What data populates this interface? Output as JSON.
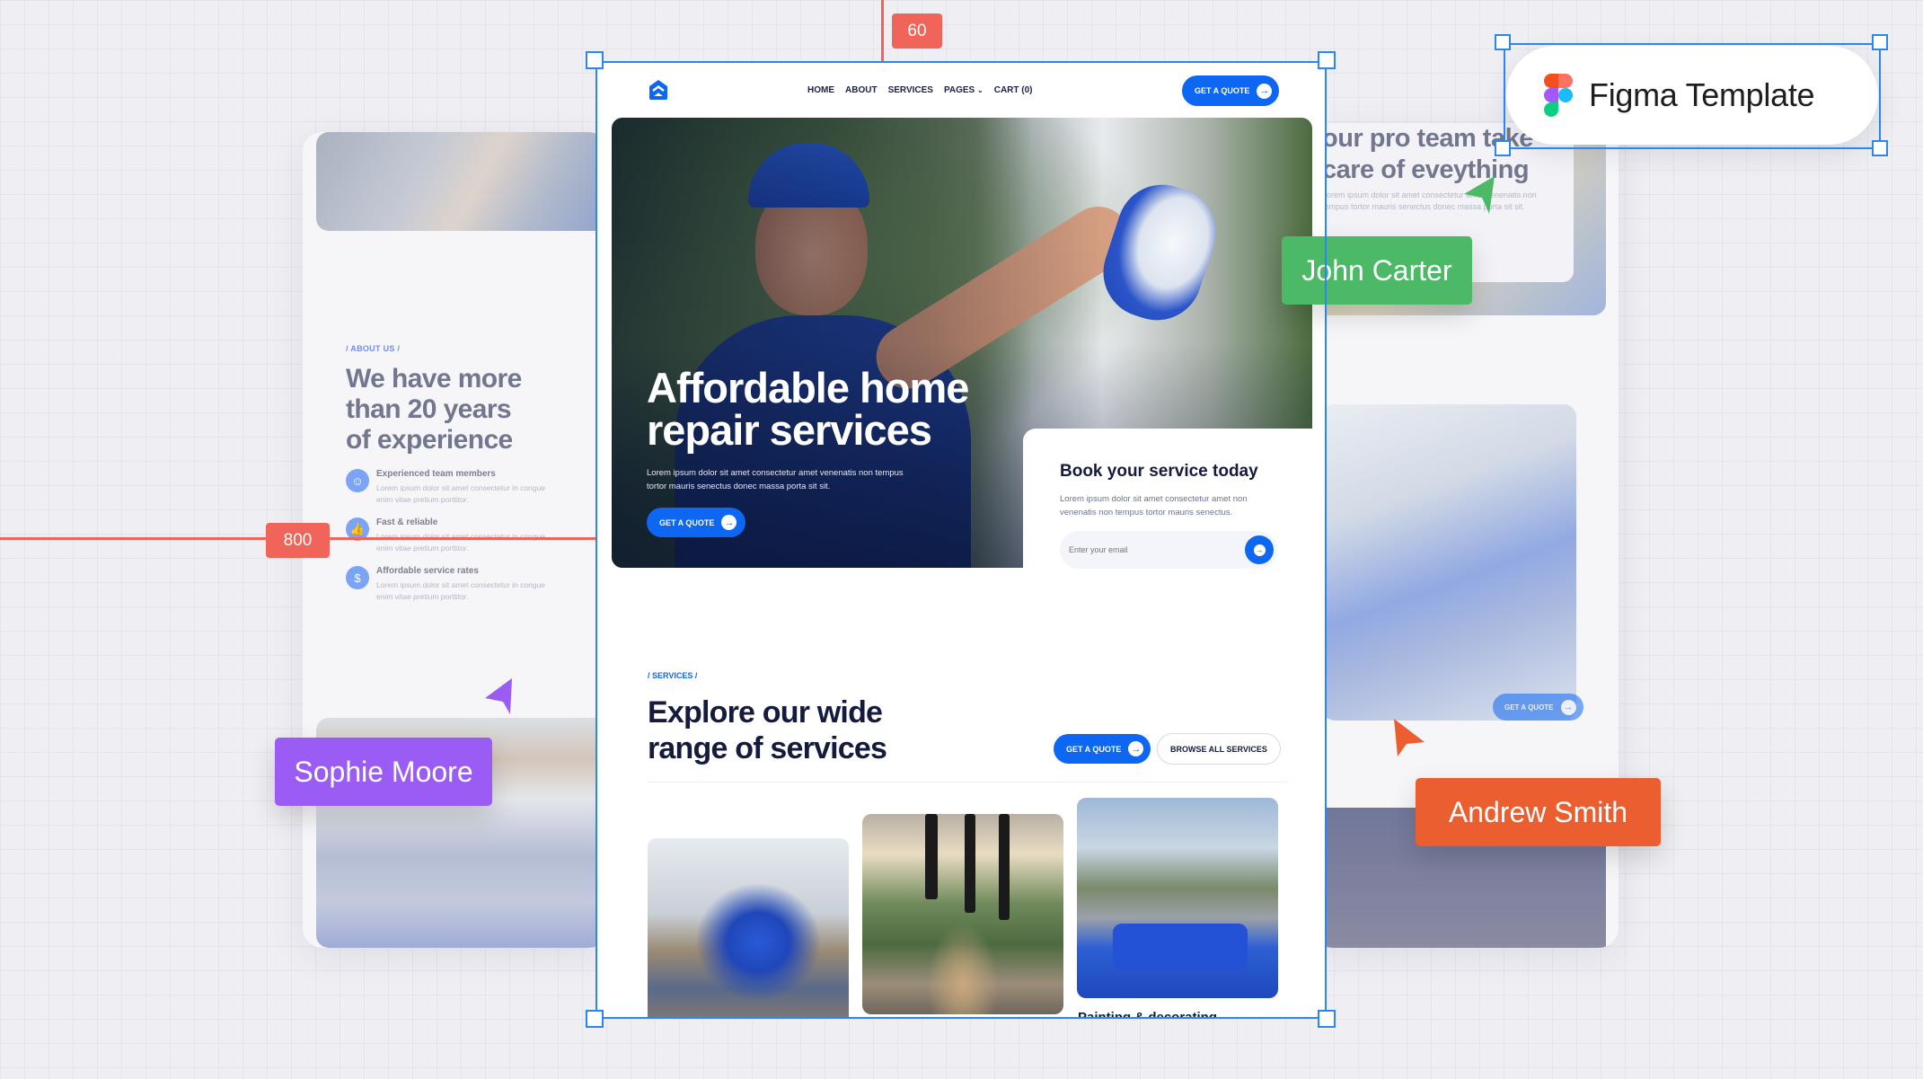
{
  "overlay": {
    "figma_label": "Figma Template",
    "measure_top": "60",
    "measure_left": "800",
    "cursors": [
      {
        "name": "John Carter",
        "color": "#4cb966"
      },
      {
        "name": "Sophie Moore",
        "color": "#9b5cf6"
      },
      {
        "name": "Andrew Smith",
        "color": "#eb5e30"
      }
    ]
  },
  "nav": {
    "logo_icon": "home-chevrons-icon",
    "links": [
      "HOME",
      "ABOUT",
      "SERVICES",
      "PAGES",
      "CART (0)"
    ],
    "cta": "GET A QUOTE"
  },
  "hero": {
    "title_line1": "Affordable home",
    "title_line2": "repair services",
    "subtitle": "Lorem ipsum dolor sit amet consectetur amet venenatis non tempus tortor mauris senectus donec massa porta sit sit.",
    "cta": "GET A QUOTE"
  },
  "booking": {
    "title": "Book your service today",
    "subtitle": "Lorem ipsum dolor sit amet consectetur amet non venenatis non tempus tortor mauris senectus.",
    "email_placeholder": "Enter your email"
  },
  "services": {
    "tag": "/ SERVICES /",
    "title_line1": "Explore our wide",
    "title_line2": "range of services",
    "cta": "GET A QUOTE",
    "browse": "BROWSE ALL SERVICES",
    "cards": [
      {
        "image": "drill",
        "caption": ""
      },
      {
        "image": "pendant-lights",
        "caption": ""
      },
      {
        "image": "paint-roller",
        "caption": "Painting & decorating"
      }
    ]
  },
  "about_card": {
    "tag": "/ ABOUT US /",
    "title_line1": "We have more",
    "title_line2": "than 20 years",
    "title_line3": "of experience",
    "features": [
      {
        "icon": "team-icon",
        "title": "Experienced team members",
        "desc": "Lorem ipsum dolor sit amet consectetur in congue enim vitae pretium porttitor."
      },
      {
        "icon": "thumbs-up-icon",
        "title": "Fast & reliable",
        "desc": "Lorem ipsum dolor sit amet consectetur in congue enim vitae pretium porttitor."
      },
      {
        "icon": "dollar-icon",
        "title": "Affordable service rates",
        "desc": "Lorem ipsum dolor sit amet consectetur in congue enim vitae pretium porttitor."
      }
    ]
  },
  "right_card": {
    "title_line1": "our pro team take",
    "title_line2": "care of eveything",
    "desc_line1": "Lorem ipsum dolor sit amet consectetur amet venenatis non",
    "desc_line2": "tempus tortor mauris senectus donec massa porta sit sit.",
    "cta": "GET A QUOTE"
  }
}
